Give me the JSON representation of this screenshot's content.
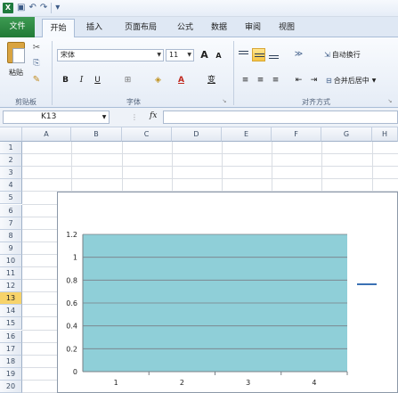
{
  "title_bar": {
    "app_icon": "X",
    "undo_icon": "↶",
    "redo_icon": "↷",
    "customize_icon": "▾"
  },
  "tabs": [
    "文件",
    "开始",
    "插入",
    "页面布局",
    "公式",
    "数据",
    "审阅",
    "视图"
  ],
  "ribbon": {
    "clipboard": {
      "paste_label": "粘贴",
      "group_label": "剪贴板"
    },
    "font": {
      "font_name": "宋体",
      "font_size": "11",
      "group_label": "字体",
      "bold": "B",
      "italic": "I",
      "underline": "U",
      "grow": "A",
      "shrink": "A",
      "phonetic": "变"
    },
    "alignment": {
      "wrap_text": "自动换行",
      "merge_center": "合并后居中",
      "group_label": "对齐方式"
    }
  },
  "formula_bar": {
    "name_box": "K13",
    "fx_label": "fx",
    "formula": ""
  },
  "columns": [
    "A",
    "B",
    "C",
    "D",
    "E",
    "F",
    "G",
    "H"
  ],
  "rows": [
    "1",
    "2",
    "3",
    "4",
    "5",
    "6",
    "7",
    "8",
    "9",
    "10",
    "11",
    "12",
    "13",
    "14",
    "15",
    "16",
    "17",
    "18",
    "19",
    "20"
  ],
  "selected_row": "13",
  "colors": {
    "fill": "#8fcfd8",
    "legend_line": "#3a71b4",
    "selected_row": "#f7d36a"
  },
  "chart_data": {
    "type": "area",
    "x": [
      "1",
      "2",
      "3",
      "4"
    ],
    "series": [
      {
        "values": [
          1.2,
          1.2,
          1.2,
          1.2
        ]
      }
    ],
    "ylim": [
      0,
      1.2
    ],
    "yticks": [
      "0",
      "0.2",
      "0.4",
      "0.6",
      "0.8",
      "1",
      "1.2"
    ],
    "grid": true,
    "legend": "right"
  }
}
